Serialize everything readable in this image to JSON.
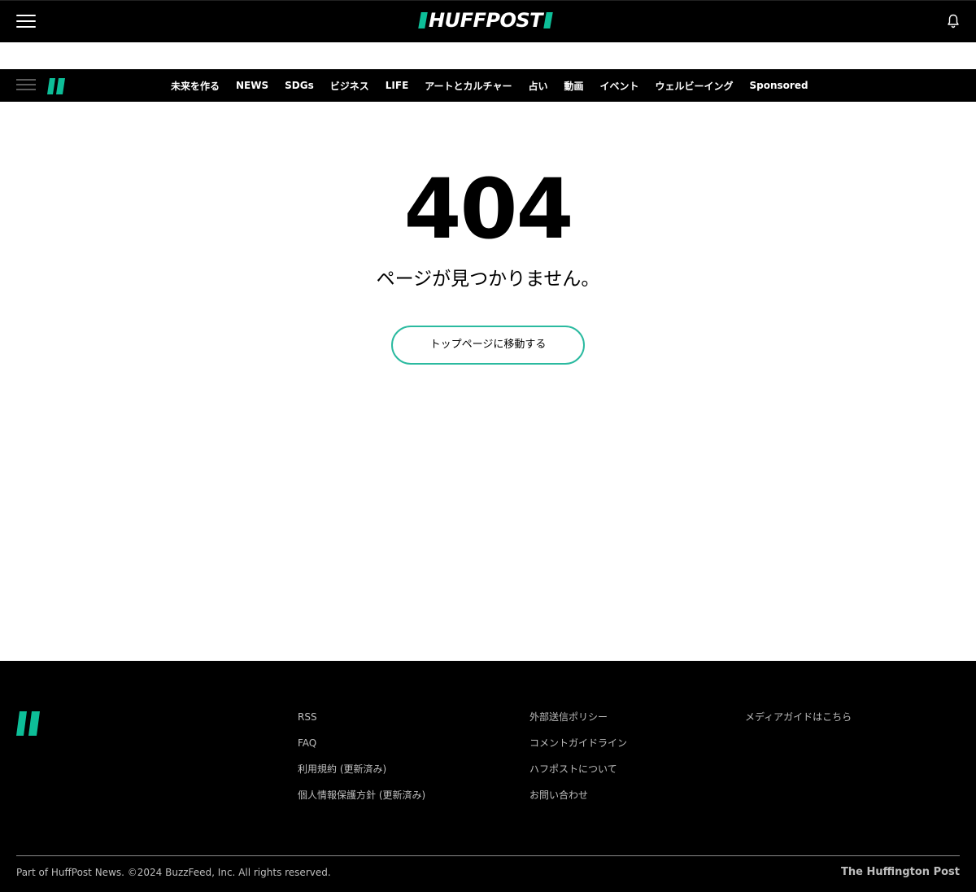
{
  "header": {
    "logo_text": "HUFFPOST",
    "menu_icon": "hamburger-menu-icon",
    "notification_icon": "bell-icon"
  },
  "nav": {
    "items": [
      {
        "label": "未来を作る"
      },
      {
        "label": "NEWS"
      },
      {
        "label": "SDGs"
      },
      {
        "label": "ビジネス"
      },
      {
        "label": "LIFE"
      },
      {
        "label": "アートとカルチャー"
      },
      {
        "label": "占い"
      },
      {
        "label": "動画"
      },
      {
        "label": "イベント"
      },
      {
        "label": "ウェルビーイング"
      },
      {
        "label": "Sponsored"
      }
    ]
  },
  "error": {
    "code": "404",
    "message": "ページが見つかりません。",
    "button_label": "トップページに移動する"
  },
  "footer": {
    "col1": [
      {
        "label": "RSS"
      },
      {
        "label": "FAQ"
      },
      {
        "label": "利用規約 (更新済み)"
      },
      {
        "label": "個人情報保護方針 (更新済み)"
      }
    ],
    "col2": [
      {
        "label": "外部送信ポリシー"
      },
      {
        "label": "コメントガイドライン"
      },
      {
        "label": "ハフポストについて"
      },
      {
        "label": "お問い合わせ"
      }
    ],
    "col3": [
      {
        "label": "メディアガイドはこちら"
      }
    ],
    "copyright": "Part of HuffPost News. ©2024 BuzzFeed, Inc. All rights reserved.",
    "brand": "The Huffington Post"
  },
  "colors": {
    "accent": "#0dbe98",
    "button_border": "#2bbaa0",
    "header_bg": "#000000"
  }
}
